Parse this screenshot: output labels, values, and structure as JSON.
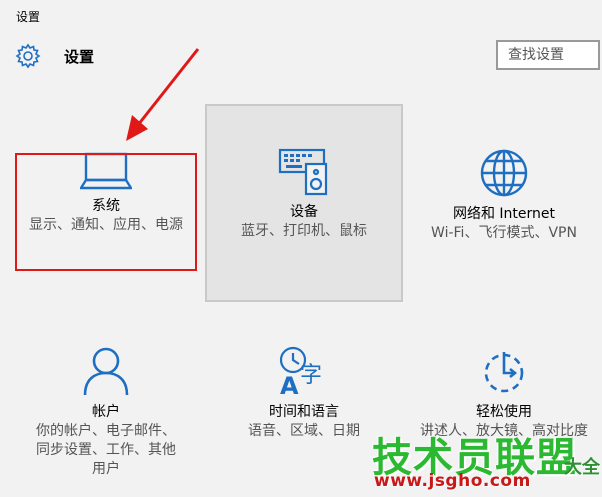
{
  "window": {
    "title": "设置"
  },
  "header": {
    "title": "设置",
    "icon": "gear-icon"
  },
  "search": {
    "placeholder": "查找设置"
  },
  "colors": {
    "accent": "#1e6fc1",
    "highlight_box": "#e01818",
    "watermark_green": "#2ab930",
    "watermark_red": "#c81818"
  },
  "tiles": [
    {
      "icon": "laptop-icon",
      "title": "系统",
      "subtitle": "显示、通知、应用、电源"
    },
    {
      "icon": "devices-icon",
      "title": "设备",
      "subtitle": "蓝牙、打印机、鼠标"
    },
    {
      "icon": "globe-icon",
      "title": "网络和 Internet",
      "subtitle": "Wi-Fi、飞行模式、VPN"
    },
    {
      "icon": "person-icon",
      "title": "帐户",
      "subtitle": "你的帐户、电子邮件、同步设置、工作、其他用户"
    },
    {
      "icon": "time-language-icon",
      "title": "时间和语言",
      "subtitle": "语音、区域、日期"
    },
    {
      "icon": "ease-of-access-icon",
      "title": "轻松使用",
      "subtitle": "讲述人、放大镜、高对比度"
    }
  ],
  "watermark": {
    "brand": "技术员联盟",
    "side": "大全",
    "url": "www.jsgho.com"
  }
}
